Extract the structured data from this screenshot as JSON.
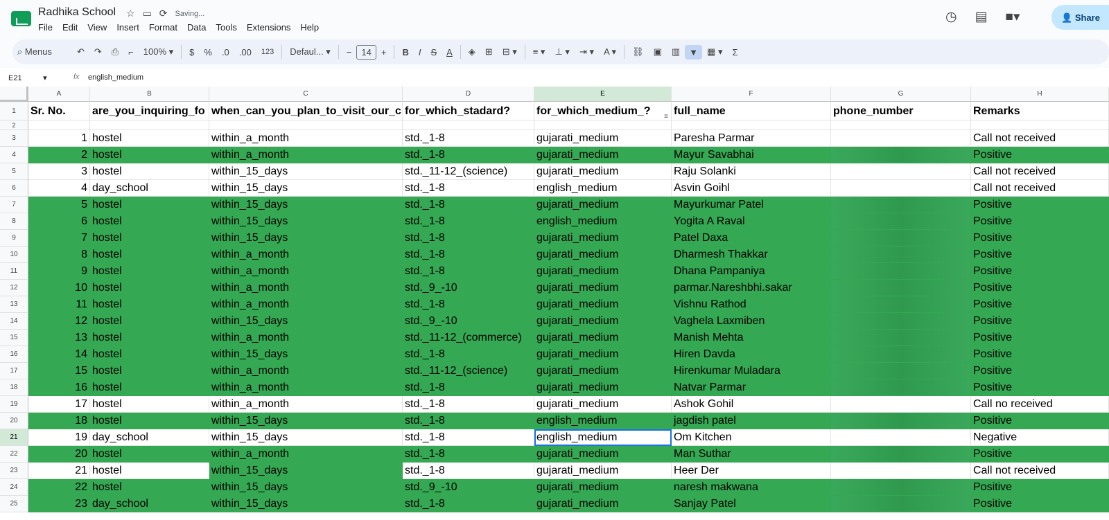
{
  "app": {
    "doc_title": "Radhika School",
    "saving_status": "Saving...",
    "menu": [
      "File",
      "Edit",
      "View",
      "Insert",
      "Format",
      "Data",
      "Tools",
      "Extensions",
      "Help"
    ],
    "share_label": "Share"
  },
  "toolbar": {
    "menus_label": "Menus",
    "zoom": "100%",
    "currency": "$",
    "percent": "%",
    "dec_decrease": ".0",
    "dec_increase": ".00",
    "number_format": "123",
    "font": "Defaul...",
    "font_size": "14"
  },
  "formula_bar": {
    "cell_ref": "E21",
    "fx": "fx",
    "value": "english_medium"
  },
  "columns": [
    "A",
    "B",
    "C",
    "D",
    "E",
    "F",
    "G",
    "H"
  ],
  "header_row": [
    "Sr. No.",
    "are_you_inquiring_fo",
    "when_can_you_plan_to_visit_our_c",
    "for_which_stadard?",
    "for_which_medium_?",
    "full_name",
    "phone_number",
    "Remarks"
  ],
  "rows": [
    {
      "n": "3",
      "sr": "1",
      "b": "hostel",
      "c": "within_a_month",
      "d": "std._1-8",
      "e": "gujarati_medium",
      "f": "Paresha Parmar",
      "h": "Call not received"
    },
    {
      "n": "4",
      "sr": "2",
      "b": "hostel",
      "c": "within_a_month",
      "d": "std._1-8",
      "e": "gujarati_medium",
      "f": "Mayur Savabhai",
      "h": "Positive"
    },
    {
      "n": "5",
      "sr": "3",
      "b": "hostel",
      "c": "within_15_days",
      "d": "std._11-12_(science)",
      "e": "gujarati_medium",
      "f": "Raju Solanki",
      "h": "Call not received"
    },
    {
      "n": "6",
      "sr": "4",
      "b": "day_school",
      "c": "within_15_days",
      "d": "std._1-8",
      "e": "english_medium",
      "f": "Asvin Goihl",
      "h": "Call not received"
    },
    {
      "n": "7",
      "sr": "5",
      "b": "hostel",
      "c": "within_15_days",
      "d": "std._1-8",
      "e": "gujarati_medium",
      "f": "Mayurkumar Patel",
      "h": "Positive"
    },
    {
      "n": "8",
      "sr": "6",
      "b": "hostel",
      "c": "within_15_days",
      "d": "std._1-8",
      "e": "english_medium",
      "f": "Yogita A Raval",
      "h": "Positive"
    },
    {
      "n": "9",
      "sr": "7",
      "b": "hostel",
      "c": "within_15_days",
      "d": "std._1-8",
      "e": "gujarati_medium",
      "f": "Patel Daxa",
      "h": "Positive"
    },
    {
      "n": "10",
      "sr": "8",
      "b": "hostel",
      "c": "within_a_month",
      "d": "std._1-8",
      "e": "gujarati_medium",
      "f": "Dharmesh Thakkar",
      "h": "Positive"
    },
    {
      "n": "11",
      "sr": "9",
      "b": "hostel",
      "c": "within_a_month",
      "d": "std._1-8",
      "e": "gujarati_medium",
      "f": "Dhana Pampaniya",
      "h": "Positive"
    },
    {
      "n": "12",
      "sr": "10",
      "b": "hostel",
      "c": "within_a_month",
      "d": "std._9_-10",
      "e": "gujarati_medium",
      "f": "parmar.Nareshbhi.sakar",
      "h": "Positive"
    },
    {
      "n": "13",
      "sr": "11",
      "b": "hostel",
      "c": "within_a_month",
      "d": "std._1-8",
      "e": "gujarati_medium",
      "f": "Vishnu Rathod",
      "h": "Positive"
    },
    {
      "n": "14",
      "sr": "12",
      "b": "hostel",
      "c": "within_15_days",
      "d": "std._9_-10",
      "e": "gujarati_medium",
      "f": "Vaghela Laxmiben",
      "h": "Positive"
    },
    {
      "n": "15",
      "sr": "13",
      "b": "hostel",
      "c": "within_a_month",
      "d": "std._11-12_(commerce)",
      "e": "gujarati_medium",
      "f": "Manish Mehta",
      "h": "Positive"
    },
    {
      "n": "16",
      "sr": "14",
      "b": "hostel",
      "c": "within_15_days",
      "d": "std._1-8",
      "e": "gujarati_medium",
      "f": "Hiren Davda",
      "h": "Positive"
    },
    {
      "n": "17",
      "sr": "15",
      "b": "hostel",
      "c": "within_a_month",
      "d": "std._11-12_(science)",
      "e": "gujarati_medium",
      "f": "Hirenkumar Muladara",
      "h": "Positive"
    },
    {
      "n": "18",
      "sr": "16",
      "b": "hostel",
      "c": "within_a_month",
      "d": "std._1-8",
      "e": "gujarati_medium",
      "f": "Natvar Parmar",
      "h": "Positive"
    },
    {
      "n": "19",
      "sr": "17",
      "b": "hostel",
      "c": "within_a_month",
      "d": "std._1-8",
      "e": "gujarati_medium",
      "f": "Ashok Gohil",
      "h": "Call no received"
    },
    {
      "n": "20",
      "sr": "18",
      "b": "hostel",
      "c": "within_15_days",
      "d": "std._1-8",
      "e": "english_medium",
      "f": "jagdish patel",
      "h": "Positive"
    },
    {
      "n": "21",
      "sr": "19",
      "b": "day_school",
      "c": "within_15_days",
      "d": "std._1-8",
      "e": "english_medium",
      "f": "Om Kitchen",
      "h": "Negative"
    },
    {
      "n": "22",
      "sr": "20",
      "b": "hostel",
      "c": "within_a_month",
      "d": "std._1-8",
      "e": "gujarati_medium",
      "f": "Man Suthar",
      "h": "Positive"
    },
    {
      "n": "23",
      "sr": "21",
      "b": "hostel",
      "c": "within_15_days",
      "d": "std._1-8",
      "e": "gujarati_medium",
      "f": "Heer Der",
      "h": "Call not received"
    },
    {
      "n": "24",
      "sr": "22",
      "b": "hostel",
      "c": "within_15_days",
      "d": "std._9_-10",
      "e": "gujarati_medium",
      "f": "naresh makwana",
      "h": "Positive"
    },
    {
      "n": "25",
      "sr": "23",
      "b": "day_school",
      "c": "within_15_days",
      "d": "std._1-8",
      "e": "gujarati_medium",
      "f": "Sanjay Patel",
      "h": "Positive"
    }
  ]
}
